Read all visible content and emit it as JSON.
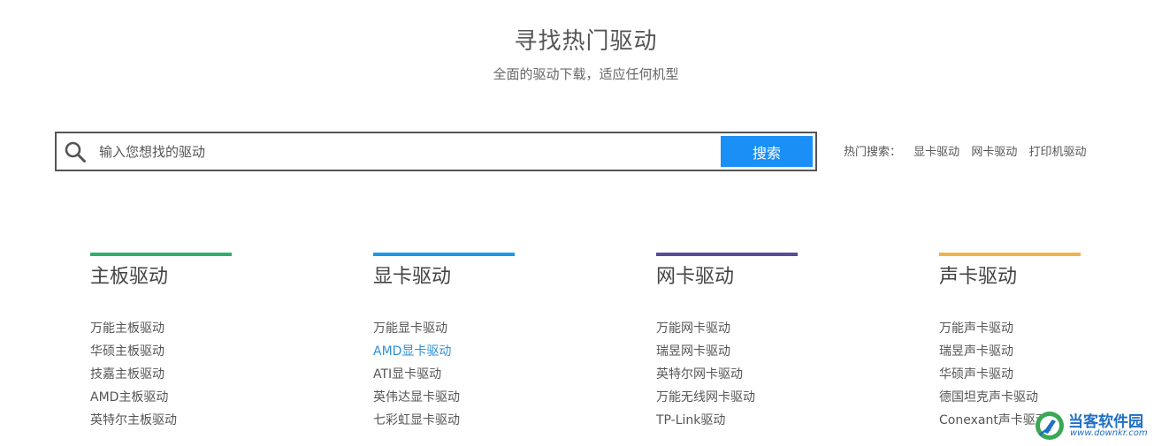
{
  "header": {
    "title": "寻找热门驱动",
    "subtitle": "全面的驱动下载，适应任何机型"
  },
  "search": {
    "placeholder": "输入您想找的驱动",
    "value": "",
    "button_label": "搜索",
    "icon": "search-icon"
  },
  "hot_search": {
    "label": "热门搜索：",
    "links": [
      "显卡驱动",
      "网卡驱动",
      "打印机驱动"
    ]
  },
  "categories": [
    {
      "title": "主板驱动",
      "accent": "#2fb06a",
      "items": [
        "万能主板驱动",
        "华硕主板驱动",
        "技嘉主板驱动",
        "AMD主板驱动",
        "英特尔主板驱动"
      ]
    },
    {
      "title": "显卡驱动",
      "accent": "#1a9ae8",
      "items": [
        "万能显卡驱动",
        "AMD显卡驱动",
        "ATI显卡驱动",
        "英伟达显卡驱动",
        "七彩虹显卡驱动"
      ]
    },
    {
      "title": "网卡驱动",
      "accent": "#5a4a9a",
      "items": [
        "万能网卡驱动",
        "瑞昱网卡驱动",
        "英特尔网卡驱动",
        "万能无线网卡驱动",
        "TP-Link驱动"
      ]
    },
    {
      "title": "声卡驱动",
      "accent": "#f0b34a",
      "items": [
        "万能声卡驱动",
        "瑞昱声卡驱动",
        "华硕声卡驱动",
        "德国坦克声卡驱动",
        "Conexant声卡驱动"
      ]
    }
  ],
  "active_item": "AMD显卡驱动",
  "colors": {
    "active_link": "#2f8fd8",
    "search_button": "#1a8ff5"
  },
  "watermark": {
    "name": "当客软件园",
    "url": "www.downkr.com"
  }
}
